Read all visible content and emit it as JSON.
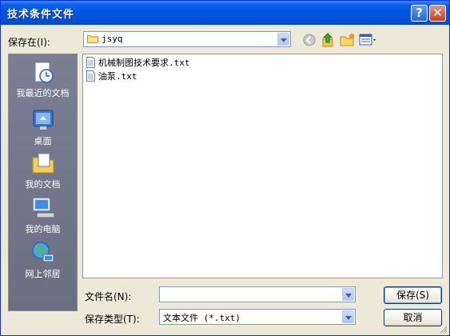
{
  "window": {
    "title": "技术条件文件"
  },
  "titlebar": {
    "help_label": "?",
    "close_label": "✕"
  },
  "lookin": {
    "label": "保存在(I):",
    "value": "jsyq"
  },
  "places": [
    {
      "label": "我最近的文档",
      "icon": "recent-documents-icon"
    },
    {
      "label": "桌面",
      "icon": "desktop-icon"
    },
    {
      "label": "我的文档",
      "icon": "my-documents-icon"
    },
    {
      "label": "我的电脑",
      "icon": "my-computer-icon"
    },
    {
      "label": "网上邻居",
      "icon": "network-places-icon"
    }
  ],
  "files": [
    {
      "name": "机械制图技术要求.txt"
    },
    {
      "name": "油泵.txt"
    }
  ],
  "filename": {
    "label": "文件名(N):",
    "value": ""
  },
  "filetype": {
    "label": "保存类型(T):",
    "value": "文本文件 (*.txt)"
  },
  "buttons": {
    "save": "保存(S)",
    "cancel": "取消"
  },
  "colors": {
    "title_bar": "#0054e3",
    "window_face": "#ece9d8",
    "places_bar": "#75778a"
  }
}
